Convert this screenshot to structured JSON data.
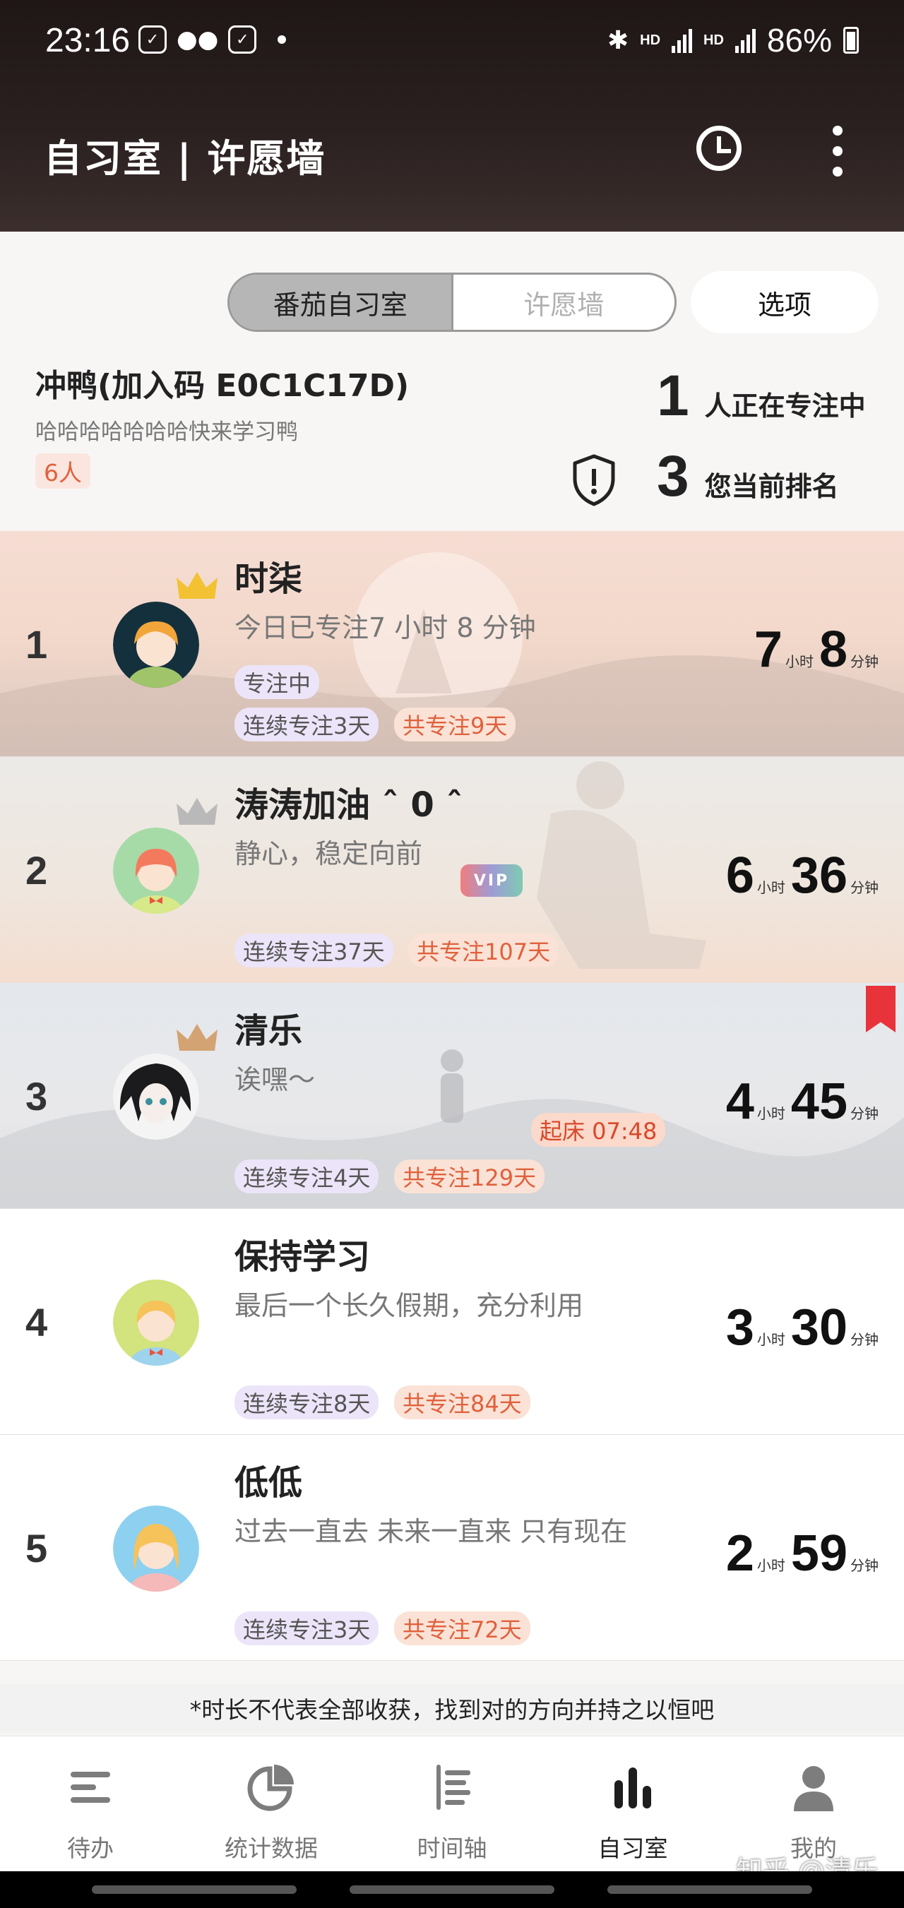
{
  "status_bar": {
    "time": "23:16",
    "net1": "HD",
    "net2": "HD",
    "battery": "86%"
  },
  "header": {
    "title": "自习室 | 许愿墙",
    "icons": [
      "clock-icon",
      "more-vertical-icon"
    ]
  },
  "segment": {
    "tabs": [
      "番茄自习室",
      "许愿墙"
    ],
    "active": 0,
    "options_label": "选项"
  },
  "room": {
    "name": "冲鸭(加入码 E0C1C17D)",
    "description": "哈哈哈哈哈哈哈快来学习鸭",
    "people_badge": "6人",
    "focusing_count": "1",
    "focusing_label": "人正在专注中",
    "my_rank": "3",
    "my_rank_label": "您当前排名"
  },
  "members": [
    {
      "rank": "1",
      "name": "时柒",
      "motto": "今日已专注7 小时 8 分钟",
      "status": "专注中",
      "streak": "连续专注3天",
      "total": "共专注9天",
      "hours": "7",
      "minutes": "8"
    },
    {
      "rank": "2",
      "name": "涛涛加油 ˆ 0 ˆ",
      "motto": "静心，稳定向前",
      "vip": "VIP",
      "streak": "连续专注37天",
      "total": "共专注107天",
      "hours": "6",
      "minutes": "36"
    },
    {
      "rank": "3",
      "name": "清乐",
      "motto": "诶嘿～",
      "wake": "起床 07:48",
      "streak": "连续专注4天",
      "total": "共专注129天",
      "hours": "4",
      "minutes": "45"
    },
    {
      "rank": "4",
      "name": "保持学习",
      "motto": "最后一个长久假期，充分利用",
      "streak": "连续专注8天",
      "total": "共专注84天",
      "hours": "3",
      "minutes": "30"
    },
    {
      "rank": "5",
      "name": "低低",
      "motto": "过去一直去 未来一直来 只有现在",
      "streak": "连续专注3天",
      "total": "共专注72天",
      "hours": "2",
      "minutes": "59"
    }
  ],
  "units": {
    "hour": "小时",
    "minute": "分钟"
  },
  "footnote": "*时长不代表全部收获，找到对的方向并持之以恒吧",
  "bottom_nav": [
    {
      "label": "待办",
      "icon": "list-icon"
    },
    {
      "label": "统计数据",
      "icon": "pie-chart-icon"
    },
    {
      "label": "时间轴",
      "icon": "timeline-icon"
    },
    {
      "label": "自习室",
      "icon": "bar-chart-icon",
      "active": true
    },
    {
      "label": "我的",
      "icon": "person-icon"
    }
  ],
  "watermark": "知乎 @清乐"
}
